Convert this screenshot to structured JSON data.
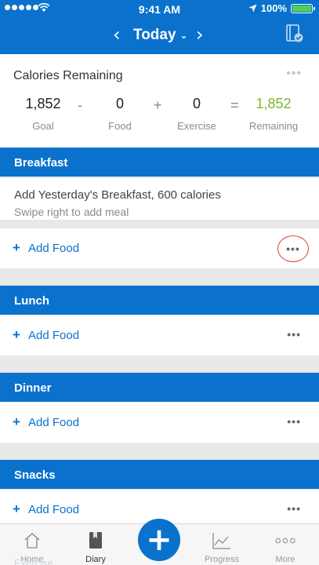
{
  "status_bar": {
    "time": "9:41 AM",
    "battery": "100%"
  },
  "nav": {
    "title": "Today",
    "prev_icon": "chevron-left-icon",
    "next_icon": "chevron-right-icon",
    "dropdown_icon": "chevron-down-icon",
    "right_icon": "diary-book-check-icon"
  },
  "calories": {
    "title": "Calories Remaining",
    "goal": {
      "value": "1,852",
      "label": "Goal"
    },
    "food": {
      "value": "0",
      "label": "Food"
    },
    "exercise": {
      "value": "0",
      "label": "Exercise"
    },
    "remaining": {
      "value": "1,852",
      "label": "Remaining"
    },
    "operators": {
      "minus": "-",
      "plus": "+",
      "equals": "="
    },
    "remaining_color": "#7ab928"
  },
  "meals": {
    "breakfast": {
      "title": "Breakfast",
      "suggestion": "Add Yesterday's Breakfast, 600 calories",
      "suggestion_hint": "Swipe right to add meal",
      "add_food": "Add Food"
    },
    "lunch": {
      "title": "Lunch",
      "add_food": "Add Food"
    },
    "dinner": {
      "title": "Dinner",
      "add_food": "Add Food"
    },
    "snacks": {
      "title": "Snacks",
      "add_food": "Add Food"
    }
  },
  "common": {
    "plus": "+",
    "more": "•••"
  },
  "tabbar": {
    "home": "Home",
    "diary": "Diary",
    "progress": "Progress",
    "more": "More",
    "add": "+"
  },
  "partially_hidden": "Exercise",
  "colors": {
    "brand": "#0a72cc",
    "highlight_ring": "#d63c3c"
  }
}
